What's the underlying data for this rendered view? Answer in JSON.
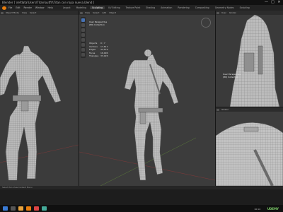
{
  "window": {
    "title": "Blender [ \\refdata\\Users\\Titan\\outfit\\Titan con ropa nueva.blend ]",
    "controls": [
      "—",
      "□",
      "✕"
    ]
  },
  "menu": {
    "items": [
      "File",
      "Edit",
      "Render",
      "Window",
      "Help"
    ],
    "tabs": [
      "Layout",
      "Modeling",
      "Sculpting",
      "UV Editing",
      "Texture Paint",
      "Shading",
      "Animation",
      "Rendering",
      "Compositing",
      "Geometry Nodes",
      "Scripting"
    ],
    "active_tab": "Sculpting"
  },
  "viewports": {
    "center": {
      "header": [
        "View",
        "Select",
        "Add",
        "Object"
      ],
      "overlay_title": "User Perspective",
      "overlay_sub": "(86) Collection",
      "stats": [
        {
          "k": "Objects",
          "v": "0 / 7"
        },
        {
          "k": "Vertices",
          "v": "17,611"
        },
        {
          "k": "Edges",
          "v": "34,579"
        },
        {
          "k": "Faces",
          "v": "16,996"
        },
        {
          "k": "Triangles",
          "v": "33,926"
        }
      ]
    },
    "right_top": {
      "header": [
        "User",
        "Global"
      ],
      "overlay_title": "User Perspective",
      "overlay_sub": "(86) Collection"
    },
    "right_bottom": {
      "header": [
        "Global"
      ]
    },
    "left": {
      "header": [
        "Object Mode",
        "View",
        "Select"
      ]
    }
  },
  "status": {
    "text": "Select   Pan View   Context Menu"
  },
  "taskbar": {
    "clock": "10:14",
    "brand": "UDEMY"
  },
  "colors": {
    "accent": "#4772b3",
    "brand": "#e87d0d",
    "mesh": "#bdbdbd"
  }
}
